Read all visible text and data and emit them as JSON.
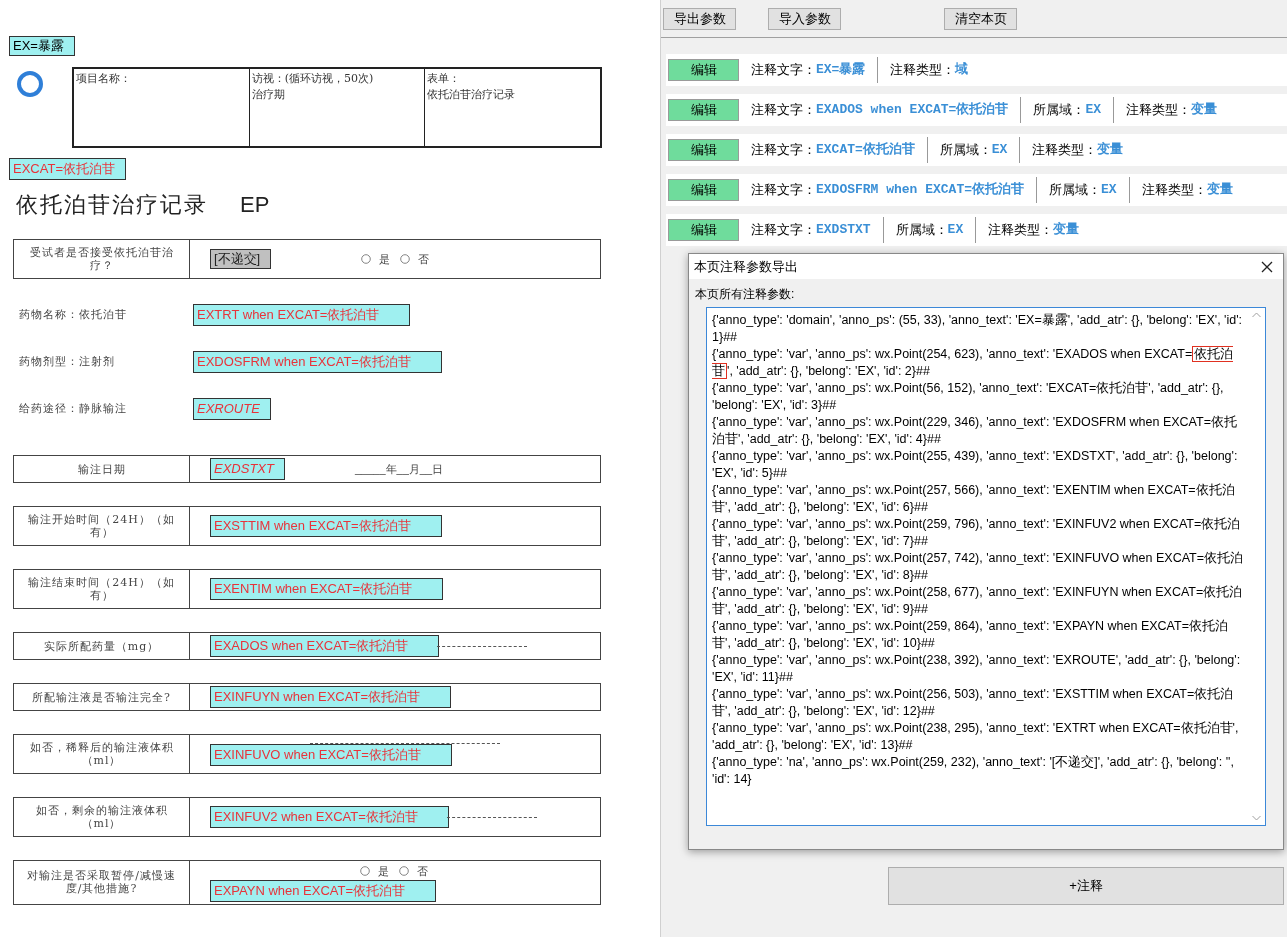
{
  "document": {
    "header_annotation": {
      "kind": "domain",
      "text": "EX=暴露",
      "italic": false
    },
    "header_table": [
      [
        "项目名称："
      ],
      [
        "访视：(循环访视，50次)",
        "治疗期"
      ],
      [
        "表单：",
        "依托泊苷治疗记录"
      ]
    ],
    "category_annotation": {
      "kind": "var",
      "text": "EXCAT=依托泊苷",
      "italic": false
    },
    "title": "依托泊苷治疗记录",
    "title_code": "EP",
    "rows": [
      {
        "kind": "boxed",
        "label": "受试者是否接受依托泊苷治疗？",
        "content": [
          {
            "kind": "na",
            "text": "[不递交]",
            "italic": false
          },
          {
            "kind": "radio_group",
            "options": [
              {
                "label": "是",
                "selected": false
              },
              {
                "label": "否",
                "selected": false
              }
            ]
          }
        ]
      },
      {
        "kind": "plain",
        "label": "药物名称：依托泊苷",
        "content": [
          {
            "kind": "var",
            "text": "EXTRT when EXCAT=依托泊苷",
            "italic": false
          }
        ]
      },
      {
        "kind": "plain",
        "label": "药物剂型：注射剂",
        "content": [
          {
            "kind": "var",
            "text": "EXDOSFRM when EXCAT=依托泊苷",
            "italic": false
          }
        ]
      },
      {
        "kind": "plain",
        "label": "给药途径：静脉输注",
        "content": [
          {
            "kind": "var",
            "text": "EXROUTE",
            "italic": true
          }
        ]
      },
      {
        "kind": "boxed",
        "label": "输注日期",
        "content": [
          {
            "kind": "var",
            "text": "EXDSTXT",
            "italic": true
          },
          {
            "kind": "date",
            "text": "_____年__月__日"
          }
        ]
      },
      {
        "kind": "boxed",
        "label": "输注开始时间（24H）（如有）",
        "content": [
          {
            "kind": "var",
            "text": "EXSTTIM when EXCAT=依托泊苷",
            "italic": false
          }
        ]
      },
      {
        "kind": "boxed",
        "label": "输注结束时间（24H）（如有）",
        "content": [
          {
            "kind": "var",
            "text": "EXENTIM when EXCAT=依托泊苷",
            "italic": false
          }
        ]
      },
      {
        "kind": "boxed",
        "label": "实际所配药量（mg）",
        "content": [
          {
            "kind": "var",
            "text": "EXADOS when EXCAT=依托泊苷",
            "italic": false
          },
          {
            "kind": "blank_line"
          }
        ]
      },
      {
        "kind": "boxed",
        "label": "所配输注液是否输注完全?",
        "content": [
          {
            "kind": "var",
            "text": "EXINFUYN when EXCAT=依托泊苷",
            "italic": false
          }
        ]
      },
      {
        "kind": "boxed",
        "label": "如否，稀释后的输注液体积（ml）",
        "content": [
          {
            "kind": "blank_line"
          },
          {
            "kind": "var",
            "text": "EXINFUVO when EXCAT=依托泊苷",
            "italic": false
          }
        ]
      },
      {
        "kind": "boxed",
        "label": "如否，剩余的输注液体积（ml）",
        "content": [
          {
            "kind": "var",
            "text": "EXINFUV2 when EXCAT=依托泊苷",
            "italic": false
          },
          {
            "kind": "blank_line"
          }
        ]
      },
      {
        "kind": "boxed",
        "label": "对输注是否采取暂停/减慢速度/其他措施?",
        "content": [
          {
            "kind": "radio_group",
            "options": [
              {
                "label": "是",
                "selected": false
              },
              {
                "label": "否",
                "selected": false
              }
            ]
          },
          {
            "kind": "var",
            "text": "EXPAYN when EXCAT=依托泊苷",
            "italic": false
          }
        ]
      }
    ]
  },
  "toolbar": [
    "导出参数",
    "导入参数",
    "清空本页"
  ],
  "annotation_list": [
    {
      "button": "编辑",
      "fields": [
        {
          "label": "注释文字：",
          "value": "EX=暴露"
        },
        {
          "label": "注释类型：",
          "value": "域"
        }
      ]
    },
    {
      "button": "编辑",
      "fields": [
        {
          "label": "注释文字：",
          "value": "EXADOS when EXCAT=依托泊苷"
        },
        {
          "label": "所属域：",
          "value": "EX"
        },
        {
          "label": "注释类型：",
          "value": "变量"
        }
      ]
    },
    {
      "button": "编辑",
      "fields": [
        {
          "label": "注释文字：",
          "value": "EXCAT=依托泊苷"
        },
        {
          "label": "所属域：",
          "value": "EX"
        },
        {
          "label": "注释类型：",
          "value": "变量"
        }
      ]
    },
    {
      "button": "编辑",
      "fields": [
        {
          "label": "注释文字：",
          "value": "EXDOSFRM when EXCAT=依托泊苷"
        },
        {
          "label": "所属域：",
          "value": "EX"
        },
        {
          "label": "注释类型：",
          "value": "变量"
        }
      ]
    },
    {
      "button": "编辑",
      "fields": [
        {
          "label": "注释文字：",
          "value": "EXDSTXT"
        },
        {
          "label": "所属域：",
          "value": "EX"
        },
        {
          "label": "注释类型：",
          "value": "变量"
        }
      ]
    }
  ],
  "dialog": {
    "title": "本页注释参数导出",
    "label": "本页所有注释参数:",
    "entries": [
      {
        "segments": [
          {
            "text": "{'anno_type': 'domain', 'anno_ps': (55, 33), 'anno_text': 'EX=暴露', 'add_atr': {}, 'belong': 'EX', 'id': 1}##",
            "boxed": false
          }
        ]
      },
      {
        "segments": [
          {
            "text": "{'anno_type': 'var', 'anno_ps': wx.Point(254, 623), 'anno_text': 'EXADOS when EXCAT=",
            "boxed": false
          },
          {
            "text": "依托泊苷",
            "boxed": true
          },
          {
            "text": "', 'add_atr': {}, 'belong': 'EX', 'id': 2}##",
            "boxed": false
          }
        ]
      },
      {
        "segments": [
          {
            "text": "{'anno_type': 'var', 'anno_ps': wx.Point(56, 152), 'anno_text': 'EXCAT=依托泊苷', 'add_atr': {}, 'belong': 'EX', 'id': 3}##",
            "boxed": false
          }
        ]
      },
      {
        "segments": [
          {
            "text": "{'anno_type': 'var', 'anno_ps': wx.Point(229, 346), 'anno_text': 'EXDOSFRM when EXCAT=依托泊苷', 'add_atr': {}, 'belong': 'EX', 'id': 4}##",
            "boxed": false
          }
        ]
      },
      {
        "segments": [
          {
            "text": "{'anno_type': 'var', 'anno_ps': wx.Point(255, 439), 'anno_text': 'EXDSTXT', 'add_atr': {}, 'belong': 'EX', 'id': 5}##",
            "boxed": false
          }
        ]
      },
      {
        "segments": [
          {
            "text": "{'anno_type': 'var', 'anno_ps': wx.Point(257, 566), 'anno_text': 'EXENTIM when EXCAT=依托泊苷', 'add_atr': {}, 'belong': 'EX', 'id': 6}##",
            "boxed": false
          }
        ]
      },
      {
        "segments": [
          {
            "text": "{'anno_type': 'var', 'anno_ps': wx.Point(259, 796), 'anno_text': 'EXINFUV2 when EXCAT=依托泊苷', 'add_atr': {}, 'belong': 'EX', 'id': 7}##",
            "boxed": false
          }
        ]
      },
      {
        "segments": [
          {
            "text": "{'anno_type': 'var', 'anno_ps': wx.Point(257, 742), 'anno_text': 'EXINFUVO when EXCAT=依托泊苷', 'add_atr': {}, 'belong': 'EX', 'id': 8}##",
            "boxed": false
          }
        ]
      },
      {
        "segments": [
          {
            "text": "{'anno_type': 'var', 'anno_ps': wx.Point(258, 677), 'anno_text': 'EXINFUYN when EXCAT=依托泊苷', 'add_atr': {}, 'belong': 'EX', 'id': 9}##",
            "boxed": false
          }
        ]
      },
      {
        "segments": [
          {
            "text": "{'anno_type': 'var', 'anno_ps': wx.Point(259, 864), 'anno_text': 'EXPAYN when EXCAT=依托泊苷', 'add_atr': {}, 'belong': 'EX', 'id': 10}##",
            "boxed": false
          }
        ]
      },
      {
        "segments": [
          {
            "text": "{'anno_type': 'var', 'anno_ps': wx.Point(238, 392), 'anno_text': 'EXROUTE', 'add_atr': {}, 'belong': 'EX', 'id': 11}##",
            "boxed": false
          }
        ]
      },
      {
        "segments": [
          {
            "text": "{'anno_type': 'var', 'anno_ps': wx.Point(256, 503), 'anno_text': 'EXSTTIM when EXCAT=依托泊苷', 'add_atr': {}, 'belong': 'EX', 'id': 12}##",
            "boxed": false
          }
        ]
      },
      {
        "segments": [
          {
            "text": "{'anno_type': 'var', 'anno_ps': wx.Point(238, 295), 'anno_text': 'EXTRT when EXCAT=依托泊苷', 'add_atr': {}, 'belong': 'EX', 'id': 13}##",
            "boxed": false
          }
        ]
      },
      {
        "segments": [
          {
            "text": "{'anno_type': 'na', 'anno_ps': wx.Point(259, 232), 'anno_text': '[不递交]', 'add_atr': {}, 'belong': '', 'id': 14}",
            "boxed": false
          }
        ]
      }
    ]
  },
  "add_button": "+注释"
}
